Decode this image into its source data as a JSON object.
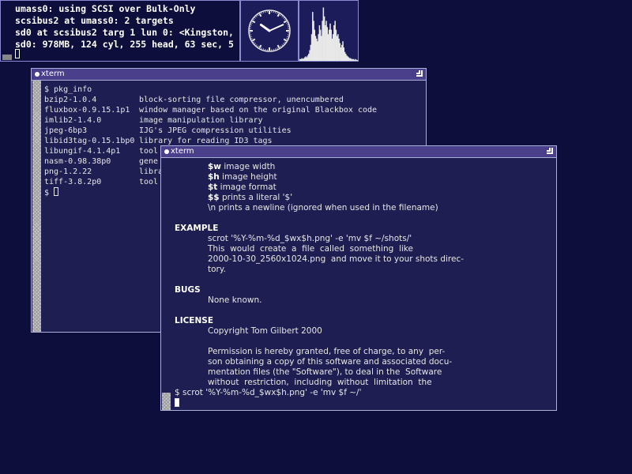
{
  "console": {
    "lines": [
      "umass0: using SCSI over Bulk-Only",
      "scsibus2 at umass0: 2 targets",
      "sd0 at scsibus2 targ 1 lun 0: <Kingston,",
      "sd0: 978MB, 124 cyl, 255 head, 63 sec, 5"
    ]
  },
  "clock": {
    "hour": 10,
    "minute": 11
  },
  "cpu_graph": {
    "values": [
      2,
      2,
      3,
      2,
      3,
      4,
      5,
      4,
      6,
      8,
      12,
      18,
      30,
      55,
      45,
      35,
      28,
      25,
      22,
      30,
      40,
      35,
      28,
      45,
      60,
      50,
      40,
      45,
      38,
      30,
      35,
      42,
      35,
      25,
      30,
      40,
      45,
      35,
      28,
      30,
      25,
      20,
      15,
      18,
      22,
      15,
      10,
      8,
      6,
      5,
      4,
      3,
      3,
      2,
      2,
      2,
      1,
      2,
      1,
      1
    ],
    "color": "#e8e8e8"
  },
  "xterm1": {
    "title": "xterm",
    "prompt": "$ pkg_info",
    "packages": [
      {
        "name": "bzip2-1.0.4",
        "desc": "block-sorting file compressor, unencumbered"
      },
      {
        "name": "fluxbox-0.9.15.1p1",
        "desc": "window manager based on the original Blackbox code"
      },
      {
        "name": "imlib2-1.4.0",
        "desc": "image manipulation library"
      },
      {
        "name": "jpeg-6bp3",
        "desc": "IJG's JPEG compression utilities"
      },
      {
        "name": "libid3tag-0.15.1bp0",
        "desc": "library for reading ID3 tags"
      },
      {
        "name": "libungif-4.1.4p1",
        "desc": "tool"
      },
      {
        "name": "nasm-0.98.38p0",
        "desc": "gene"
      },
      {
        "name": "png-1.2.22",
        "desc": "libra"
      },
      {
        "name": "tiff-3.8.2p0",
        "desc": "tool"
      }
    ],
    "last_prompt": "$ "
  },
  "xterm2": {
    "title": "xterm",
    "format_lines": [
      {
        "code": "$w",
        "text": " image width"
      },
      {
        "code": "$h",
        "text": " image height"
      },
      {
        "code": "$t",
        "text": " image format"
      },
      {
        "code": "$$",
        "text": " prints a literal '$'"
      },
      {
        "code": "",
        "text": "\\n prints a newline (ignored when used in the filename)"
      }
    ],
    "example_heading": "EXAMPLE",
    "example_cmd": "scrot '%Y-%m-%d_$wx$h.png' -e 'mv $f ~/shots/'",
    "example_desc": [
      "This  would  create  a  file  called  something  like",
      "2000-10-30_2560x1024.png  and move it to your shots direc-",
      "tory."
    ],
    "bugs_heading": "BUGS",
    "bugs_text": "None known.",
    "license_heading": "LICENSE",
    "license_copyright": "Copyright Tom Gilbert 2000",
    "license_text": [
      "Permission is hereby granted, free of charge, to any  per-",
      "son obtaining a copy of this software and associated docu-",
      "mentation files (the \"Software\"), to deal in the  Software",
      "without  restriction,  including  without  limitation  the"
    ],
    "command_line": "$ scrot '%Y-%m-%d_$wx$h.png' -e 'mv $f ~/'"
  }
}
